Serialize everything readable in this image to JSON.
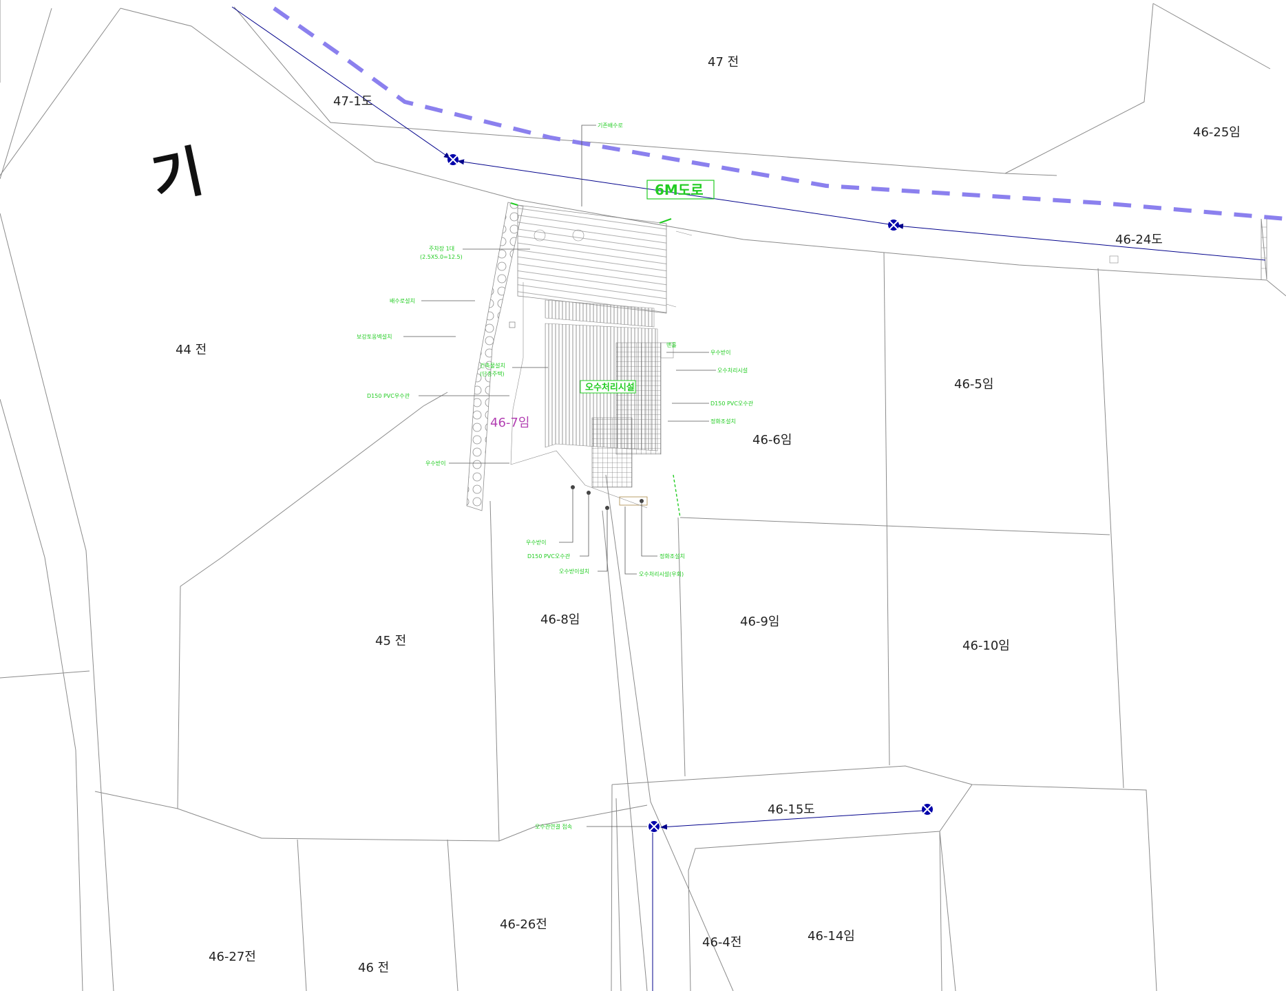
{
  "colors": {
    "boundary": "#8a8a8a",
    "road_dash": "#8b80ee",
    "annotation": "#22cc22",
    "flow": "#00008b",
    "highlight_parcel": "#b23fb2",
    "text": "#222222"
  },
  "north_arrow": {
    "label": "기"
  },
  "road": {
    "label": "6M도로"
  },
  "facility": {
    "label": "오수처리시설"
  },
  "parcels": {
    "p47": "47 전",
    "p47_1": "47-1도",
    "p46_25": "46-25임",
    "p44": "44 전",
    "p46_24": "46-24도",
    "p46_5": "46-5임",
    "p46_7": "46-7임",
    "p46_6": "46-6임",
    "p46_8": "46-8임",
    "p46_9": "46-9임",
    "p45": "45 전",
    "p46_10": "46-10임",
    "p46_15": "46-15도",
    "p46_26": "46-26전",
    "p46_4": "46-4전",
    "p46_14": "46-14임",
    "p46_27": "46-27전",
    "p46": "46 전"
  },
  "notes": {
    "n1": "기존배수로",
    "n2": "주차장 1대",
    "n3": "(2.5X5.0=12.5)",
    "n4": "배수로설치",
    "n5": "보강토옹벽설치",
    "n6": "건축물설치",
    "n7": "(단층주택)",
    "n8": "D150 PVC우수관",
    "n9": "우수받이",
    "n10": "맨홀",
    "n11": "우수받이",
    "n12": "오수처리시설",
    "n13": "D150 PVC오수관",
    "n14": "정화조설치",
    "n15": "우수받이",
    "n16": "D150 PVC오수관",
    "n17": "오수받이설치",
    "n18": "정화조설치",
    "n19": "오수처리시설(우회)",
    "n20": "오수관연결 접속"
  }
}
